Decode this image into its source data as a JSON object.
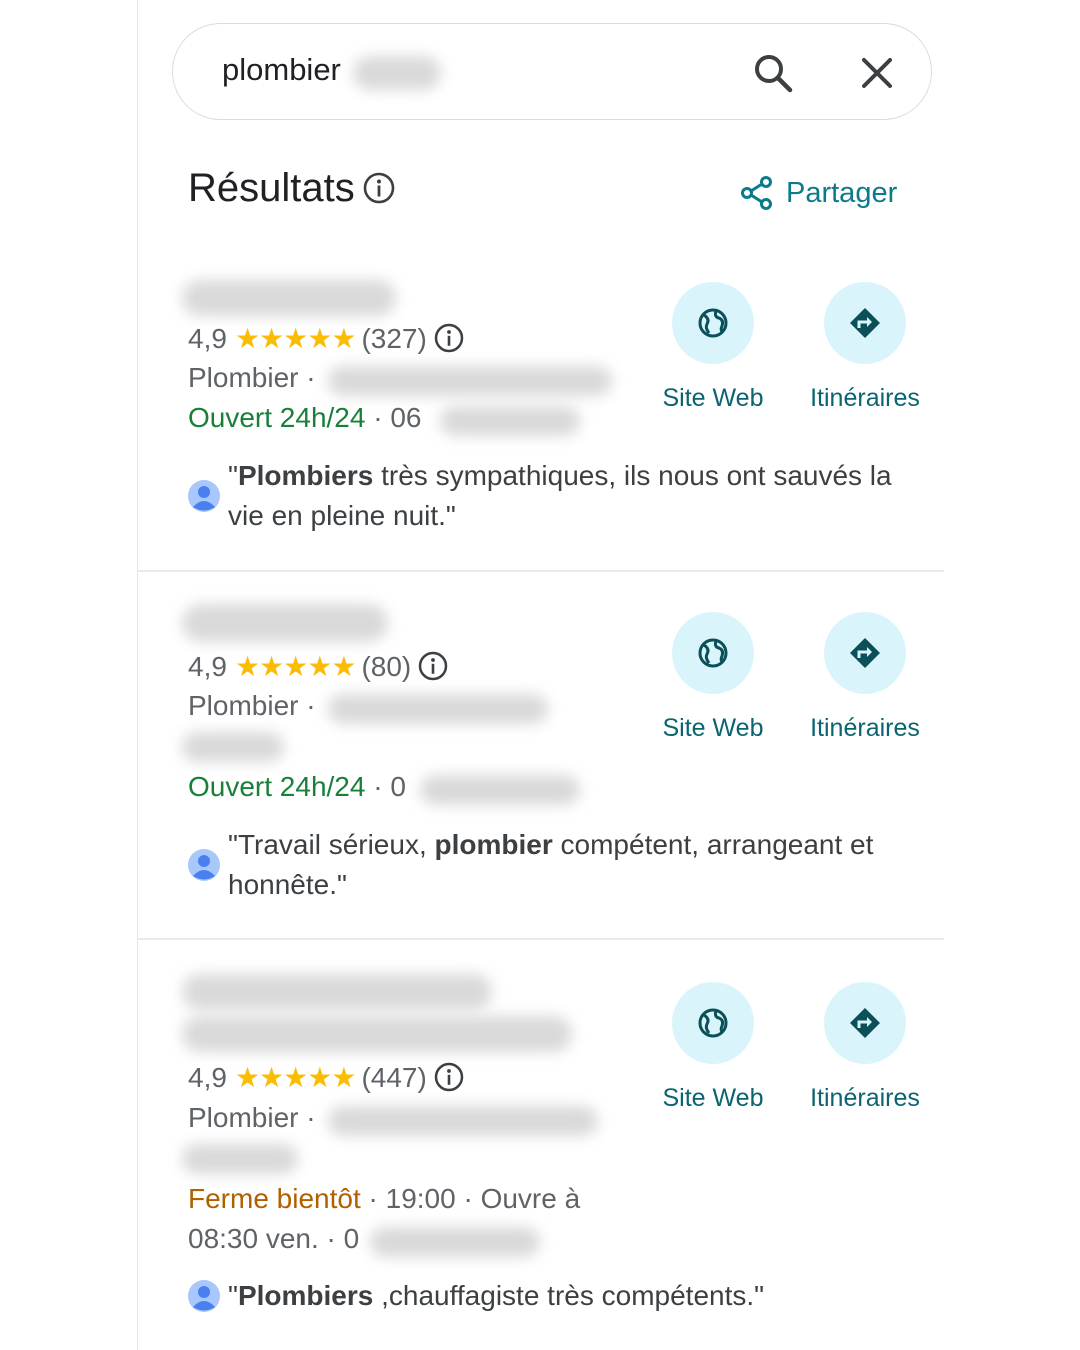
{
  "search": {
    "query": "plombier",
    "search_icon": "search-icon",
    "clear_icon": "close-icon"
  },
  "header": {
    "title": "Résultats",
    "info_icon": "info-icon",
    "share_label": "Partager",
    "share_icon": "share-icon"
  },
  "colors": {
    "accent": "#0b7a8a",
    "action_bg": "#d9f5fb",
    "star": "#fbbc04",
    "open": "#188038",
    "closing": "#b06000"
  },
  "actions": {
    "website_label": "Site Web",
    "directions_label": "Itinéraires",
    "website_icon": "globe-icon",
    "directions_icon": "directions-icon"
  },
  "results": [
    {
      "rating": "4,9",
      "stars": "★★★★★",
      "stars_value": 5,
      "reviews": "(327)",
      "category": "Plombier ·",
      "status": "Ouvert 24h/24",
      "status_rest": " · 06",
      "review_bold": "Plombiers",
      "review_rest": " très sympathiques, ils nous ont sauvés la vie en pleine nuit.\""
    },
    {
      "rating": "4,9",
      "stars": "★★★★★",
      "stars_value": 5,
      "reviews": "(80)",
      "category": "Plombier ·",
      "status": "Ouvert 24h/24",
      "status_rest": " · 0",
      "review_pre": "\"Travail sérieux, ",
      "review_bold": "plombier",
      "review_rest": " compétent, arrangeant et honnête.\""
    },
    {
      "rating": "4,9",
      "stars": "★★★★★",
      "stars_value": 5,
      "reviews": "(447)",
      "category": "Plombier ·",
      "status": "Ferme bientôt",
      "status_rest": " · 19:00 · Ouvre à",
      "status_line2": "08:30 ven. · 0",
      "review_bold": "Plombiers",
      "review_rest": " ,chauffagiste très compétents.\""
    }
  ]
}
